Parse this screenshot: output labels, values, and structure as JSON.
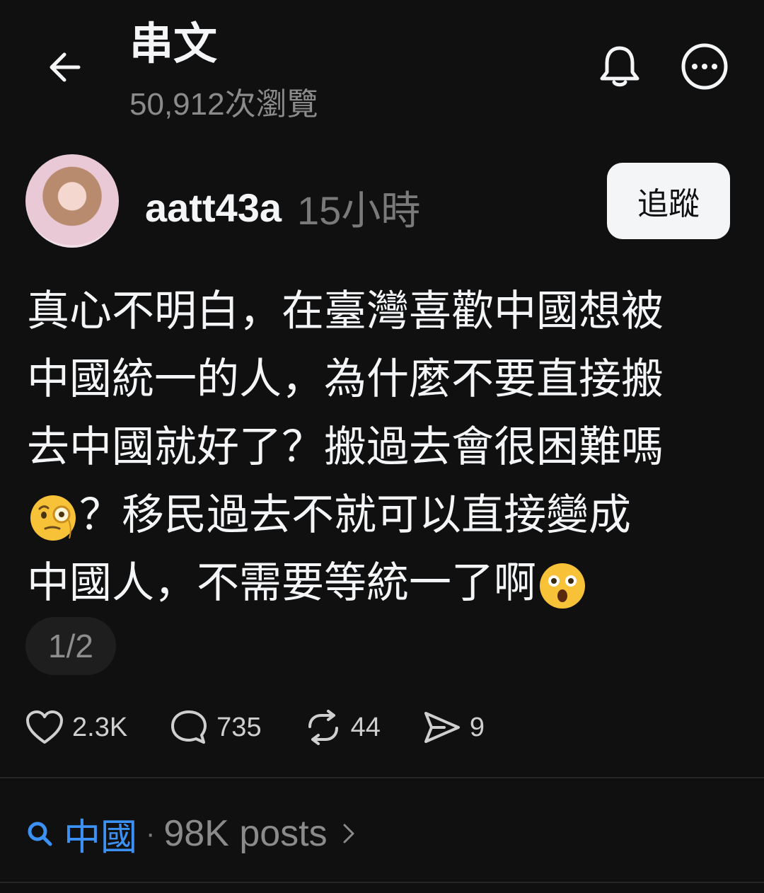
{
  "header": {
    "title": "串文",
    "views": "50,912次瀏覽"
  },
  "post": {
    "username": "aatt43a",
    "time": "15小時",
    "follow_label": "追蹤",
    "lines": [
      "真心不明白，在臺灣喜歡中國想被",
      "中國統一的人，為什麼不要直接搬",
      "去中國就好了？搬過去會很困難嗎",
      "？移民過去不就可以直接變成",
      "中國人，不需要等統一了啊"
    ],
    "emoji_1": "face-with-monocle-emoji",
    "emoji_2": "astonished-face-emoji",
    "pager": "1/2"
  },
  "actions": {
    "likes": "2.3K",
    "replies": "735",
    "reposts": "44",
    "shares": "9"
  },
  "topic": {
    "term": "中國",
    "separator": "·",
    "count": "98K posts"
  },
  "colors": {
    "background": "#101010",
    "text": "#f3f5f7",
    "muted": "#8b8b8b",
    "link": "#3b91f5"
  }
}
